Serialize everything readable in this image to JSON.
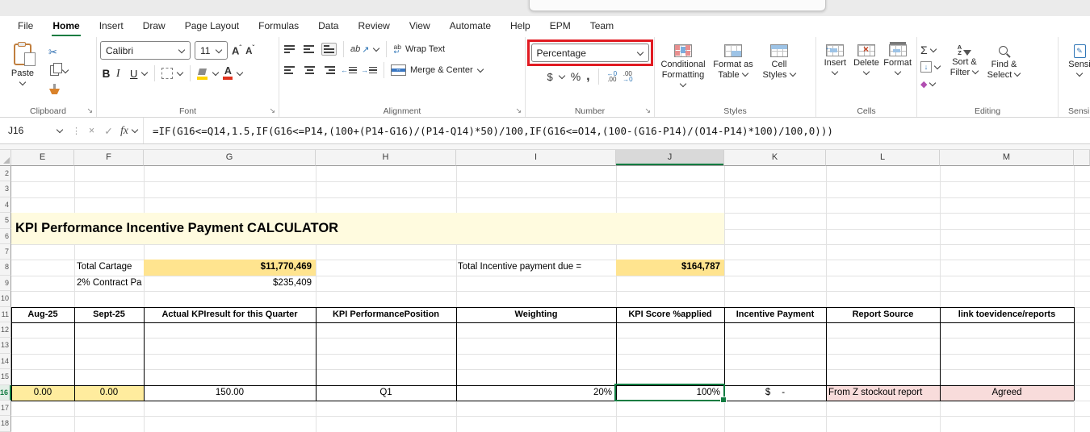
{
  "tabs": {
    "items": [
      "File",
      "Home",
      "Insert",
      "Draw",
      "Page Layout",
      "Formulas",
      "Data",
      "Review",
      "View",
      "Automate",
      "Help",
      "EPM",
      "Team"
    ],
    "active": "Home"
  },
  "ribbon": {
    "clipboard": {
      "label": "Clipboard",
      "paste": "Paste"
    },
    "font": {
      "label": "Font",
      "family": "Calibri",
      "size": "11",
      "bold": "B",
      "italic": "I",
      "underline": "U",
      "letter_a": "A"
    },
    "alignment": {
      "label": "Alignment",
      "wrap_text": "Wrap Text",
      "merge_center": "Merge & Center",
      "orientation_text": "ab"
    },
    "number": {
      "label": "Number",
      "format": "Percentage",
      "currency": "$",
      "percent": "%",
      "comma": ",",
      "inc_top": "←0",
      "inc_bottom": ".00",
      "dec_top": ".00",
      "dec_bottom": "→0"
    },
    "styles": {
      "label": "Styles",
      "conditional": "Conditional Formatting",
      "format_table": "Format as Table",
      "cell_styles": "Cell Styles"
    },
    "cells": {
      "label": "Cells",
      "insert": "Insert",
      "delete": "Delete",
      "format": "Format"
    },
    "editing": {
      "label": "Editing",
      "sort_filter": "Sort & Filter",
      "find_select": "Find & Select"
    },
    "sensitivity": {
      "label": "Sensi",
      "button": "Sensi"
    }
  },
  "formula_bar": {
    "cell_reference": "J16",
    "fx": "fx",
    "formula": "=IF(G16<=Q14,1.5,IF(G16<=P14,(100+(P14-G16)/(P14-Q14)*50)/100,IF(G16<=O14,(100-(G16-P14)/(O14-P14)*100)/100,0)))"
  },
  "grid": {
    "columns": [
      "E",
      "F",
      "G",
      "H",
      "I",
      "J",
      "K",
      "L",
      "M"
    ],
    "selected_column": "J",
    "row_numbers": [
      "2",
      "3",
      "4",
      "5",
      "6",
      "7",
      "8",
      "9",
      "10",
      "11",
      "12",
      "13",
      "14",
      "15",
      "16",
      "17",
      "18"
    ],
    "selected_row": "16",
    "title": "KPI Performance Incentive Payment CALCULATOR",
    "summary": {
      "total_cartage_label": "Total Cartage",
      "total_cartage_value": "$11,770,469",
      "contract_label": "2% Contract Pa",
      "contract_value": "$235,409",
      "incentive_label": "Total Incentive payment due =",
      "incentive_value": "$164,787"
    },
    "table": {
      "headers": [
        "Aug-25",
        "Sept-25",
        "Actual KPIresult for this Quarter",
        "KPI PerformancePosition",
        "Weighting",
        "KPI Score %applied",
        "Incentive Payment",
        "Report Source",
        "link toevidence/reports"
      ],
      "row16": {
        "aug": "0.00",
        "sept": "0.00",
        "actual": "150.00",
        "position": "Q1",
        "weighting": "20%",
        "kpi_score": "100%",
        "incentive_currency": "$",
        "incentive_value": "-",
        "report_source": "From Z stockout report",
        "evidence": "Agreed"
      }
    }
  },
  "icons": {
    "cut": "✂",
    "launcher": "↘",
    "dots": "⋮",
    "cancel": "×",
    "check": "✓",
    "autosum": "Σ",
    "fill_down": "↓",
    "eraser": "◆",
    "orientation_arrow": "↗",
    "wrap_ab": "ab",
    "wrap_arrow": "↩",
    "merge_arrows": "↔",
    "grow_caret": "ˆ",
    "shrink_caret": "ˇ",
    "sort_a": "A",
    "sort_z": "Z",
    "pencil": "✎",
    "indent_left": "←",
    "indent_right": "→"
  },
  "colors": {
    "excel_green": "#107C41",
    "annotation_red": "#E11B22",
    "yellow_strong": "#FFE48F",
    "yellow_soft": "#FFEC9E",
    "cream": "#FFFBDF",
    "pink": "#F8DCDB"
  }
}
